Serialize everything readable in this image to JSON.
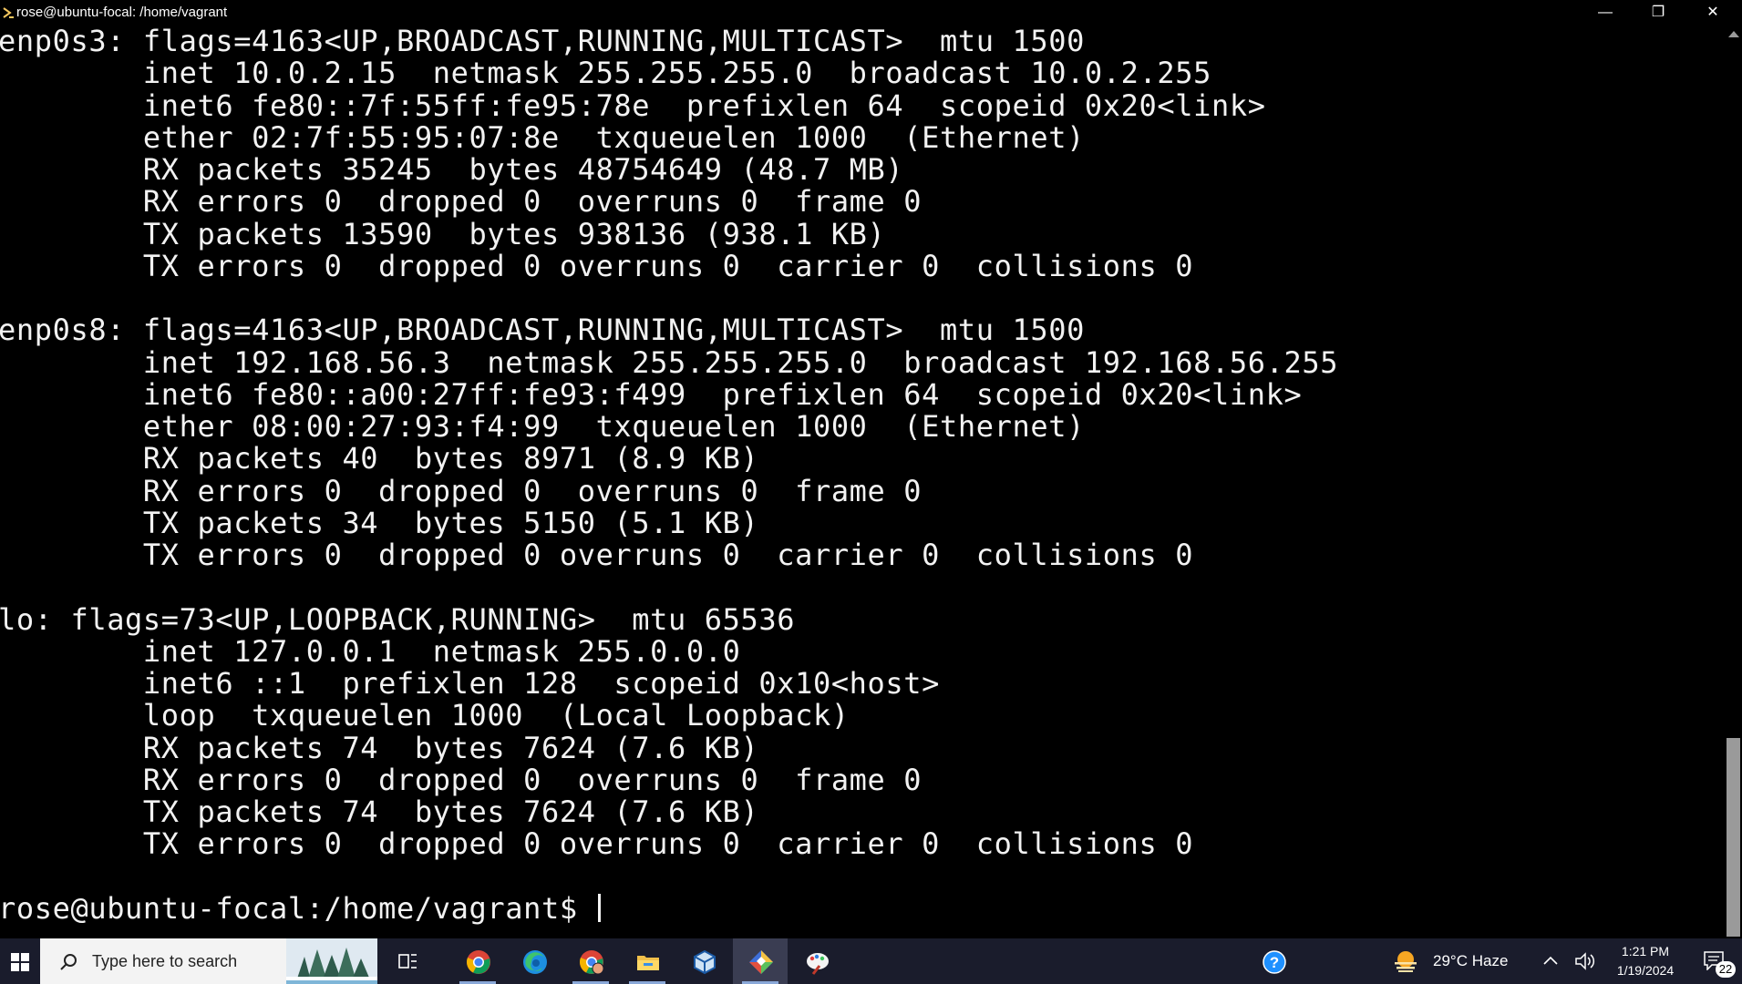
{
  "window": {
    "title": "rose@ubuntu-focal: /home/vagrant",
    "minimize_glyph": "—",
    "maximize_glyph": "❐",
    "close_glyph": "✕"
  },
  "terminal": {
    "lines": [
      "enp0s3: flags=4163<UP,BROADCAST,RUNNING,MULTICAST>  mtu 1500",
      "        inet 10.0.2.15  netmask 255.255.255.0  broadcast 10.0.2.255",
      "        inet6 fe80::7f:55ff:fe95:78e  prefixlen 64  scopeid 0x20<link>",
      "        ether 02:7f:55:95:07:8e  txqueuelen 1000  (Ethernet)",
      "        RX packets 35245  bytes 48754649 (48.7 MB)",
      "        RX errors 0  dropped 0  overruns 0  frame 0",
      "        TX packets 13590  bytes 938136 (938.1 KB)",
      "        TX errors 0  dropped 0 overruns 0  carrier 0  collisions 0",
      "",
      "enp0s8: flags=4163<UP,BROADCAST,RUNNING,MULTICAST>  mtu 1500",
      "        inet 192.168.56.3  netmask 255.255.255.0  broadcast 192.168.56.255",
      "        inet6 fe80::a00:27ff:fe93:f499  prefixlen 64  scopeid 0x20<link>",
      "        ether 08:00:27:93:f4:99  txqueuelen 1000  (Ethernet)",
      "        RX packets 40  bytes 8971 (8.9 KB)",
      "        RX errors 0  dropped 0  overruns 0  frame 0",
      "        TX packets 34  bytes 5150 (5.1 KB)",
      "        TX errors 0  dropped 0 overruns 0  carrier 0  collisions 0",
      "",
      "lo: flags=73<UP,LOOPBACK,RUNNING>  mtu 65536",
      "        inet 127.0.0.1  netmask 255.0.0.0",
      "        inet6 ::1  prefixlen 128  scopeid 0x10<host>",
      "        loop  txqueuelen 1000  (Local Loopback)",
      "        RX packets 74  bytes 7624 (7.6 KB)",
      "        RX errors 0  dropped 0  overruns 0  frame 0",
      "        TX packets 74  bytes 7624 (7.6 KB)",
      "        TX errors 0  dropped 0 overruns 0  carrier 0  collisions 0",
      "",
      "rose@ubuntu-focal:/home/vagrant$ "
    ],
    "text_color": "#f2f2f2",
    "background_color": "#000000"
  },
  "taskbar": {
    "search_placeholder": "Type here to search",
    "apps": [
      {
        "name": "chrome",
        "icon": "chrome-icon"
      },
      {
        "name": "edge",
        "icon": "edge-icon"
      },
      {
        "name": "chrome-profile",
        "icon": "chrome-profile-icon"
      },
      {
        "name": "file-explorer",
        "icon": "folder-icon"
      },
      {
        "name": "virtualbox",
        "icon": "cube-icon"
      },
      {
        "name": "git-bash",
        "icon": "git-icon"
      },
      {
        "name": "paint",
        "icon": "paint-icon"
      }
    ],
    "weather": "29°C  Haze",
    "clock_time": "1:21 PM",
    "clock_date": "1/19/2024",
    "notification_count": "22",
    "background_color": "#1a1c2c"
  }
}
